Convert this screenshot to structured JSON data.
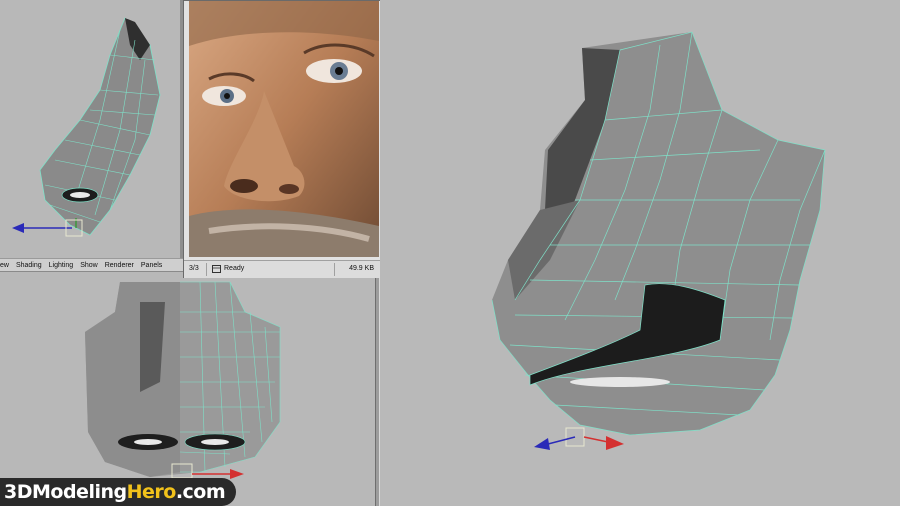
{
  "viewport_menu": {
    "items": [
      "ew",
      "Shading",
      "Lighting",
      "Show",
      "Renderer",
      "Panels"
    ]
  },
  "image_viewer": {
    "page": "3/3",
    "status": "Ready",
    "file_size": "49.9 KB"
  },
  "branding": {
    "logo_part1": "3DModeling",
    "logo_part2": "Hero",
    "logo_part3": ".com"
  },
  "colors": {
    "viewport_bg": "#b8b8b8",
    "wireframe": "#7fe0c8",
    "mesh_gray": "#8c8c8c",
    "axis_red": "#d43030",
    "axis_blue": "#2a2ab8",
    "logo_yellow": "#f2c21b"
  },
  "icons": [
    "image-icon",
    "axis-gizmo-icon"
  ]
}
